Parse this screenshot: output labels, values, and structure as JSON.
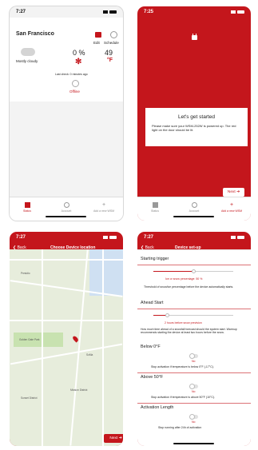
{
  "phone1": {
    "time": "7:27",
    "city": "San Francisco",
    "edit": "Edit",
    "schedule": "Schedule",
    "weather": "Mostly cloudy",
    "percentage": "0 %",
    "temperature": "49",
    "unit": "°F",
    "last_check": "Last check: 0 minutes ago",
    "offline": "Offline",
    "tabs": [
      "Status",
      "Account",
      "Add a new WSM"
    ]
  },
  "phone2": {
    "time": "7:25",
    "title": "Let's get started",
    "body": "Please make sure your WSM-252W is powered up. The red light on the door should be lit.",
    "next": "Next",
    "tabs": [
      "Status",
      "Account",
      "Add a new WSM"
    ]
  },
  "phone3": {
    "time": "7:27",
    "back": "Back",
    "title": "Choose Device location",
    "map_labels": [
      "Presidio",
      "Golden Gate Park",
      "SoMa",
      "Mission District",
      "Sunset District"
    ],
    "next": "Next"
  },
  "phone4": {
    "time": "7:27",
    "back": "Back",
    "title": "Device set-up",
    "starting_trigger": "Starting trigger",
    "snow_percentage": "Ice or snow percentage: 50 %",
    "threshold_text": "Threshold of snow/ice percentage before the device automatically starts.",
    "ahead_start": "Ahead Start",
    "ahead_value": "2 hours before snow prevision",
    "ahead_text": "How much time ahead of a snowfall forecast should the system start. Warmup recommends starting the device at least two hours before the snow.",
    "below_0": "Below 0°F",
    "no": "No",
    "below_text": "Stop activation if temperature is below 0°F (-17°C).",
    "above_50": "Above 50°F",
    "above_text": "Stop activation if temperature is above 50°F (10°C).",
    "activation_length": "Activation Length",
    "activation_text": "Stop running after 24h of activation"
  }
}
